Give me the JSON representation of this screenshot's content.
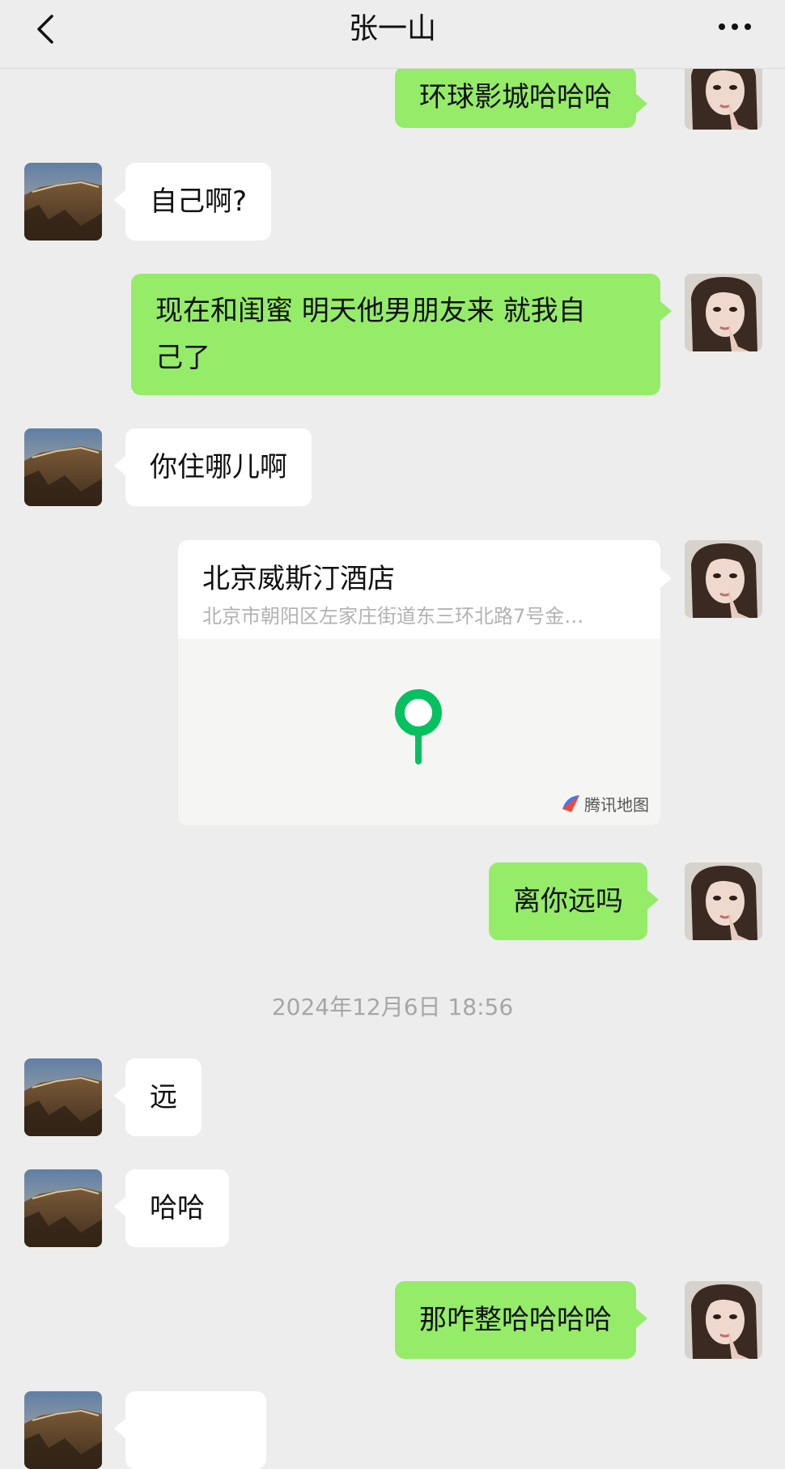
{
  "header": {
    "title": "张一山",
    "back_icon": "chevron-left-icon",
    "more_icon": "more-horizontal-icon"
  },
  "messages": [
    {
      "side": "right",
      "text": "环球影城哈哈哈"
    },
    {
      "side": "left",
      "text": "自己啊?"
    },
    {
      "side": "right",
      "line1": "现在和闺蜜 明天他男朋友来 就我自",
      "line2": "己了"
    },
    {
      "side": "left",
      "text": "你住哪儿啊"
    },
    {
      "side": "right",
      "type": "location",
      "name": "北京威斯汀酒店",
      "address": "北京市朝阳区左家庄街道东三环北路7号金…",
      "brand": "腾讯地图"
    },
    {
      "side": "right",
      "text": "离你远吗"
    },
    {
      "type": "timestamp",
      "text": "2024年12月6日 18:56"
    },
    {
      "side": "left",
      "text": "远"
    },
    {
      "side": "left",
      "text": "哈哈"
    },
    {
      "side": "right",
      "text": "那咋整哈哈哈哈"
    }
  ],
  "colors": {
    "background": "#ededed",
    "sent_bubble": "#95ec69",
    "received_bubble": "#ffffff",
    "pin": "#07c160"
  }
}
